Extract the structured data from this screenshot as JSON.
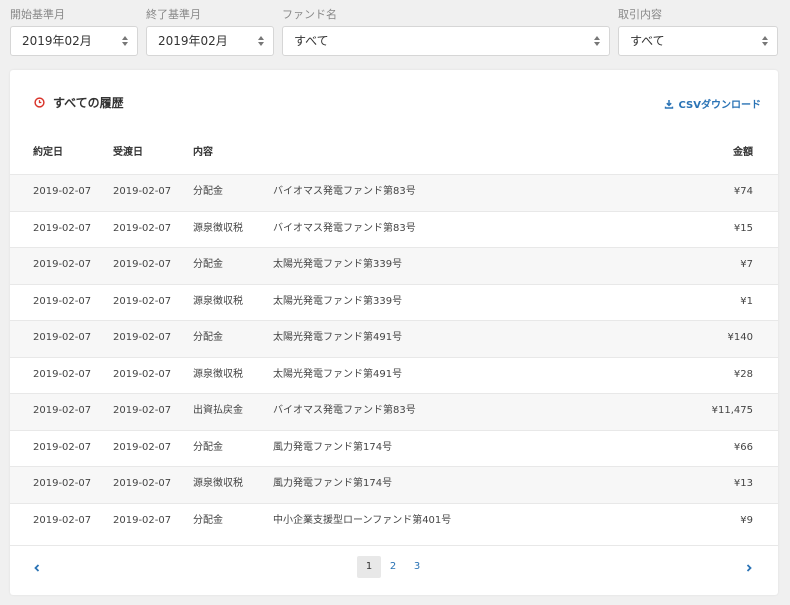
{
  "filters": {
    "start": {
      "label": "開始基準月",
      "value": "2019年02月"
    },
    "end": {
      "label": "終了基準月",
      "value": "2019年02月"
    },
    "fund": {
      "label": "ファンド名",
      "value": "すべて"
    },
    "type": {
      "label": "取引内容",
      "value": "すべて"
    }
  },
  "card": {
    "title": "すべての履歴",
    "csv_label": "CSVダウンロード"
  },
  "colors": {
    "accent": "#2a73b5",
    "clock": "#d9342b"
  },
  "table": {
    "headers": {
      "date": "約定日",
      "settle": "受渡日",
      "type": "内容",
      "amount": "金額"
    },
    "rows": [
      {
        "date": "2019-02-07",
        "settle": "2019-02-07",
        "type": "分配金",
        "fund": "バイオマス発電ファンド第83号",
        "amount": "¥74"
      },
      {
        "date": "2019-02-07",
        "settle": "2019-02-07",
        "type": "源泉徴収税",
        "fund": "バイオマス発電ファンド第83号",
        "amount": "¥15"
      },
      {
        "date": "2019-02-07",
        "settle": "2019-02-07",
        "type": "分配金",
        "fund": "太陽光発電ファンド第339号",
        "amount": "¥7"
      },
      {
        "date": "2019-02-07",
        "settle": "2019-02-07",
        "type": "源泉徴収税",
        "fund": "太陽光発電ファンド第339号",
        "amount": "¥1"
      },
      {
        "date": "2019-02-07",
        "settle": "2019-02-07",
        "type": "分配金",
        "fund": "太陽光発電ファンド第491号",
        "amount": "¥140"
      },
      {
        "date": "2019-02-07",
        "settle": "2019-02-07",
        "type": "源泉徴収税",
        "fund": "太陽光発電ファンド第491号",
        "amount": "¥28"
      },
      {
        "date": "2019-02-07",
        "settle": "2019-02-07",
        "type": "出資払戻金",
        "fund": "バイオマス発電ファンド第83号",
        "amount": "¥11,475"
      },
      {
        "date": "2019-02-07",
        "settle": "2019-02-07",
        "type": "分配金",
        "fund": "風力発電ファンド第174号",
        "amount": "¥66"
      },
      {
        "date": "2019-02-07",
        "settle": "2019-02-07",
        "type": "源泉徴収税",
        "fund": "風力発電ファンド第174号",
        "amount": "¥13"
      },
      {
        "date": "2019-02-07",
        "settle": "2019-02-07",
        "type": "分配金",
        "fund": "中小企業支援型ローンファンド第401号",
        "amount": "¥9"
      }
    ]
  },
  "pagination": {
    "pages": [
      "1",
      "2",
      "3"
    ],
    "current": "1"
  }
}
